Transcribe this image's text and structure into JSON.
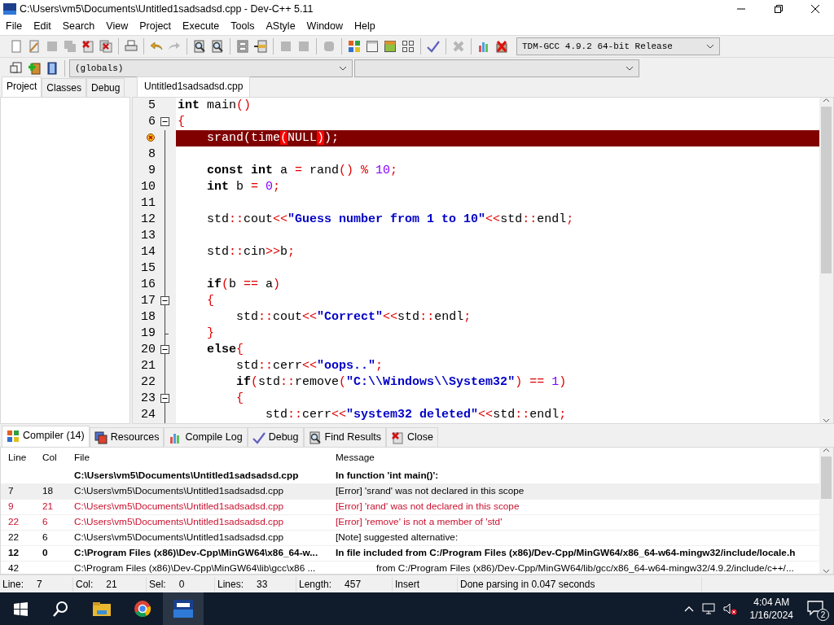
{
  "window": {
    "title": "C:\\Users\\vm5\\Documents\\Untitled1sadsadsd.cpp - Dev-C++ 5.11"
  },
  "menu": [
    "File",
    "Edit",
    "Search",
    "View",
    "Project",
    "Execute",
    "Tools",
    "AStyle",
    "Window",
    "Help"
  ],
  "toolbar": {
    "groups": [
      [
        {
          "kind": "page",
          "disabled": false
        },
        {
          "kind": "page-edit",
          "disabled": false
        },
        {
          "kind": "disk",
          "disabled": true
        },
        {
          "kind": "disks",
          "disabled": true
        },
        {
          "kind": "page-x",
          "disabled": false
        },
        {
          "kind": "pages-x",
          "disabled": false
        }
      ],
      [
        {
          "kind": "printer",
          "disabled": false
        }
      ],
      [
        {
          "kind": "undo",
          "disabled": false
        },
        {
          "kind": "redo",
          "disabled": true
        }
      ],
      [
        {
          "kind": "search",
          "disabled": false
        },
        {
          "kind": "search",
          "disabled": false
        }
      ],
      [
        {
          "kind": "two-bars",
          "disabled": false
        },
        {
          "kind": "goto",
          "disabled": false
        }
      ],
      [
        {
          "kind": "indent",
          "disabled": true
        },
        {
          "kind": "indent",
          "disabled": true
        }
      ],
      [
        {
          "kind": "stop",
          "disabled": true
        }
      ],
      [
        {
          "kind": "grid-color",
          "disabled": false
        },
        {
          "kind": "window",
          "disabled": false
        },
        {
          "kind": "window-color",
          "disabled": false
        },
        {
          "kind": "grid",
          "disabled": false
        }
      ],
      [
        {
          "kind": "check",
          "disabled": false
        }
      ],
      [
        {
          "kind": "x",
          "disabled": true
        }
      ],
      [
        {
          "kind": "bars",
          "disabled": false
        },
        {
          "kind": "debug-x",
          "disabled": false
        }
      ]
    ],
    "compiler": "TDM-GCC 4.9.2 64-bit Release",
    "buttons2": [
      {
        "kind": "page-box",
        "disabled": false
      },
      {
        "kind": "plus",
        "disabled": false
      },
      {
        "kind": "book",
        "disabled": false
      }
    ],
    "scope": "(globals)"
  },
  "side_tabs": [
    {
      "label": "Project",
      "selected": true
    },
    {
      "label": "Classes",
      "selected": false
    },
    {
      "label": "Debug",
      "selected": false
    }
  ],
  "editor_tabs": [
    {
      "label": "Untitled1sadsadsd.cpp",
      "selected": true
    }
  ],
  "code": [
    {
      "number": "5",
      "fold_start": false,
      "fold_end": false,
      "error": false,
      "tokens": [
        {
          "kind": "kw",
          "text": "int"
        },
        {
          "kind": "id",
          "text": " main"
        },
        {
          "kind": "op",
          "text": "()"
        }
      ]
    },
    {
      "number": "6",
      "fold_start": true,
      "fold_end": false,
      "error": false,
      "tokens": [
        {
          "kind": "op",
          "text": "{"
        }
      ]
    },
    {
      "error_marker": true,
      "fold_start": false,
      "fold_end": false,
      "error": true,
      "tokens": [
        {
          "kind": "id",
          "text": "    srand"
        },
        {
          "kind": "op",
          "text": "("
        },
        {
          "kind": "id",
          "text": "time"
        },
        {
          "kind": "match",
          "text": "("
        },
        {
          "kind": "id",
          "text": "NULL"
        },
        {
          "kind": "match",
          "text": ")"
        },
        {
          "kind": "op",
          "text": ");"
        }
      ]
    },
    {
      "number": "8",
      "fold_start": false,
      "fold_end": false,
      "error": false
    },
    {
      "number": "9",
      "fold_start": false,
      "fold_end": false,
      "error": false,
      "tokens": [
        {
          "kind": "kw",
          "text": "    const int"
        },
        {
          "kind": "id",
          "text": " a "
        },
        {
          "kind": "op",
          "text": "="
        },
        {
          "kind": "id",
          "text": " rand"
        },
        {
          "kind": "op",
          "text": "() %"
        },
        {
          "kind": "num",
          "text": " 10"
        },
        {
          "kind": "op",
          "text": ";"
        }
      ]
    },
    {
      "number": "10",
      "fold_start": false,
      "fold_end": false,
      "error": false,
      "tokens": [
        {
          "kind": "kw",
          "text": "    int"
        },
        {
          "kind": "id",
          "text": " b "
        },
        {
          "kind": "op",
          "text": "="
        },
        {
          "kind": "num",
          "text": " 0"
        },
        {
          "kind": "op",
          "text": ";"
        }
      ]
    },
    {
      "number": "11",
      "fold_start": false,
      "fold_end": false,
      "error": false
    },
    {
      "number": "12",
      "fold_start": false,
      "fold_end": false,
      "error": false,
      "tokens": [
        {
          "kind": "id",
          "text": "    std"
        },
        {
          "kind": "op",
          "text": "::"
        },
        {
          "kind": "id",
          "text": "cout"
        },
        {
          "kind": "op",
          "text": "<<"
        },
        {
          "kind": "str",
          "text": "\"Guess number from 1 to 10\""
        },
        {
          "kind": "op",
          "text": "<<"
        },
        {
          "kind": "id",
          "text": "std"
        },
        {
          "kind": "op",
          "text": "::"
        },
        {
          "kind": "id",
          "text": "endl"
        },
        {
          "kind": "op",
          "text": ";"
        }
      ]
    },
    {
      "number": "13",
      "fold_start": false,
      "fold_end": false,
      "error": false
    },
    {
      "number": "14",
      "fold_start": false,
      "fold_end": false,
      "error": false,
      "tokens": [
        {
          "kind": "id",
          "text": "    std"
        },
        {
          "kind": "op",
          "text": "::"
        },
        {
          "kind": "id",
          "text": "cin"
        },
        {
          "kind": "op",
          "text": ">>"
        },
        {
          "kind": "id",
          "text": "b"
        },
        {
          "kind": "op",
          "text": ";"
        }
      ]
    },
    {
      "number": "15",
      "fold_start": false,
      "fold_end": false,
      "error": false
    },
    {
      "number": "16",
      "fold_start": false,
      "fold_end": false,
      "error": false,
      "tokens": [
        {
          "kind": "kw",
          "text": "    if"
        },
        {
          "kind": "op",
          "text": "("
        },
        {
          "kind": "id",
          "text": "b "
        },
        {
          "kind": "op",
          "text": "=="
        },
        {
          "kind": "id",
          "text": " a"
        },
        {
          "kind": "op",
          "text": ")"
        }
      ]
    },
    {
      "number": "17",
      "fold_start": true,
      "fold_end": false,
      "error": false,
      "tokens": [
        {
          "kind": "op",
          "text": "    {"
        }
      ]
    },
    {
      "number": "18",
      "fold_start": false,
      "fold_end": false,
      "error": false,
      "tokens": [
        {
          "kind": "id",
          "text": "        std"
        },
        {
          "kind": "op",
          "text": "::"
        },
        {
          "kind": "id",
          "text": "cout"
        },
        {
          "kind": "op",
          "text": "<<"
        },
        {
          "kind": "str",
          "text": "\"Correct\""
        },
        {
          "kind": "op",
          "text": "<<"
        },
        {
          "kind": "id",
          "text": "std"
        },
        {
          "kind": "op",
          "text": "::"
        },
        {
          "kind": "id",
          "text": "endl"
        },
        {
          "kind": "op",
          "text": ";"
        }
      ]
    },
    {
      "number": "19",
      "fold_start": false,
      "fold_end": true,
      "error": false,
      "tokens": [
        {
          "kind": "op",
          "text": "    }"
        }
      ]
    },
    {
      "number": "20",
      "fold_start": true,
      "fold_end": false,
      "error": false,
      "tokens": [
        {
          "kind": "kw",
          "text": "    else"
        },
        {
          "kind": "op",
          "text": "{"
        }
      ]
    },
    {
      "number": "21",
      "fold_start": false,
      "fold_end": false,
      "error": false,
      "tokens": [
        {
          "kind": "id",
          "text": "        std"
        },
        {
          "kind": "op",
          "text": "::"
        },
        {
          "kind": "id",
          "text": "cerr"
        },
        {
          "kind": "op",
          "text": "<<"
        },
        {
          "kind": "str",
          "text": "\"oops..\""
        },
        {
          "kind": "op",
          "text": ";"
        }
      ]
    },
    {
      "number": "22",
      "fold_start": false,
      "fold_end": false,
      "error": false,
      "tokens": [
        {
          "kind": "kw",
          "text": "        if"
        },
        {
          "kind": "op",
          "text": "("
        },
        {
          "kind": "id",
          "text": "std"
        },
        {
          "kind": "op",
          "text": "::"
        },
        {
          "kind": "id",
          "text": "remove"
        },
        {
          "kind": "op",
          "text": "("
        },
        {
          "kind": "str",
          "text": "\"C:\\\\Windows\\\\System32\""
        },
        {
          "kind": "op",
          "text": ") =="
        },
        {
          "kind": "num",
          "text": " 1"
        },
        {
          "kind": "op",
          "text": ")"
        }
      ]
    },
    {
      "number": "23",
      "fold_start": true,
      "fold_end": false,
      "error": false,
      "tokens": [
        {
          "kind": "op",
          "text": "        {"
        }
      ]
    },
    {
      "number": "24",
      "fold_start": false,
      "fold_end": false,
      "error": false,
      "tokens": [
        {
          "kind": "id",
          "text": "            std"
        },
        {
          "kind": "op",
          "text": "::"
        },
        {
          "kind": "id",
          "text": "cerr"
        },
        {
          "kind": "op",
          "text": "<<"
        },
        {
          "kind": "str",
          "text": "\"system32 deleted\""
        },
        {
          "kind": "op",
          "text": "<<"
        },
        {
          "kind": "id",
          "text": "std"
        },
        {
          "kind": "op",
          "text": "::"
        },
        {
          "kind": "id",
          "text": "endl"
        },
        {
          "kind": "op",
          "text": ";"
        }
      ]
    }
  ],
  "bottom_tabs": [
    {
      "label": "Compiler (14)",
      "kind": "grid-color",
      "selected": true
    },
    {
      "label": "Resources",
      "kind": "windows",
      "selected": false
    },
    {
      "label": "Compile Log",
      "kind": "bars",
      "selected": false
    },
    {
      "label": "Debug",
      "kind": "check",
      "selected": false
    },
    {
      "label": "Find Results",
      "kind": "search",
      "selected": false
    },
    {
      "label": "Close",
      "kind": "page-x",
      "selected": false
    }
  ],
  "table": {
    "columns": [
      "Line",
      "Col",
      "File",
      "Message"
    ],
    "rows": [
      {
        "kind": "bold",
        "selected": false,
        "file": "C:\\Users\\vm5\\Documents\\Untitled1sadsadsd.cpp",
        "message": "In function 'int main()':"
      },
      {
        "kind": "plain",
        "selected": true,
        "line": "7",
        "col": "18",
        "file": "C:\\Users\\vm5\\Documents\\Untitled1sadsadsd.cpp",
        "message": "[Error] 'srand' was not declared in this scope"
      },
      {
        "kind": "error",
        "selected": false,
        "line": "9",
        "col": "21",
        "file": "C:\\Users\\vm5\\Documents\\Untitled1sadsadsd.cpp",
        "message": "[Error] 'rand' was not declared in this scope"
      },
      {
        "kind": "error",
        "selected": false,
        "line": "22",
        "col": "6",
        "file": "C:\\Users\\vm5\\Documents\\Untitled1sadsadsd.cpp",
        "message": "[Error] 'remove' is not a member of 'std'"
      },
      {
        "kind": "plain",
        "selected": false,
        "line": "22",
        "col": "6",
        "file": "C:\\Users\\vm5\\Documents\\Untitled1sadsadsd.cpp",
        "message": "[Note] suggested alternative:"
      },
      {
        "kind": "bold",
        "selected": false,
        "line": "12",
        "col": "0",
        "file": "C:\\Program Files (x86)\\Dev-Cpp\\MinGW64\\x86_64-w...",
        "message": "In file included from C:/Program Files (x86)/Dev-Cpp/MinGW64/x86_64-w64-mingw32/include/locale.h"
      },
      {
        "kind": "continuation",
        "selected": false,
        "line": "42",
        "file": "C:\\Program Files (x86)\\Dev-Cpp\\MinGW64\\lib\\gcc\\x86 ...",
        "message": "from C:/Program Files (x86)/Dev-Cpp/MinGW64/lib/gcc/x86_64-w64-mingw32/4.9.2/include/c++/..."
      }
    ]
  },
  "status_bar": [
    {
      "label": "Line:",
      "value": "7"
    },
    {
      "label": "Col:",
      "value": "21"
    },
    {
      "label": "Sel:",
      "value": "0"
    },
    {
      "label": "Lines:",
      "value": "33"
    },
    {
      "label": "Length:",
      "value": "457"
    },
    {
      "value": "Insert"
    },
    {
      "value": "Done parsing in 0.047 seconds"
    }
  ],
  "taskbar": {
    "apps": [
      {
        "kind": "folder",
        "selected": false
      },
      {
        "kind": "browser",
        "selected": false
      },
      {
        "kind": "devcpp",
        "selected": true
      }
    ],
    "time": "4:04 AM",
    "date": "1/16/2024",
    "notifications": "2"
  }
}
